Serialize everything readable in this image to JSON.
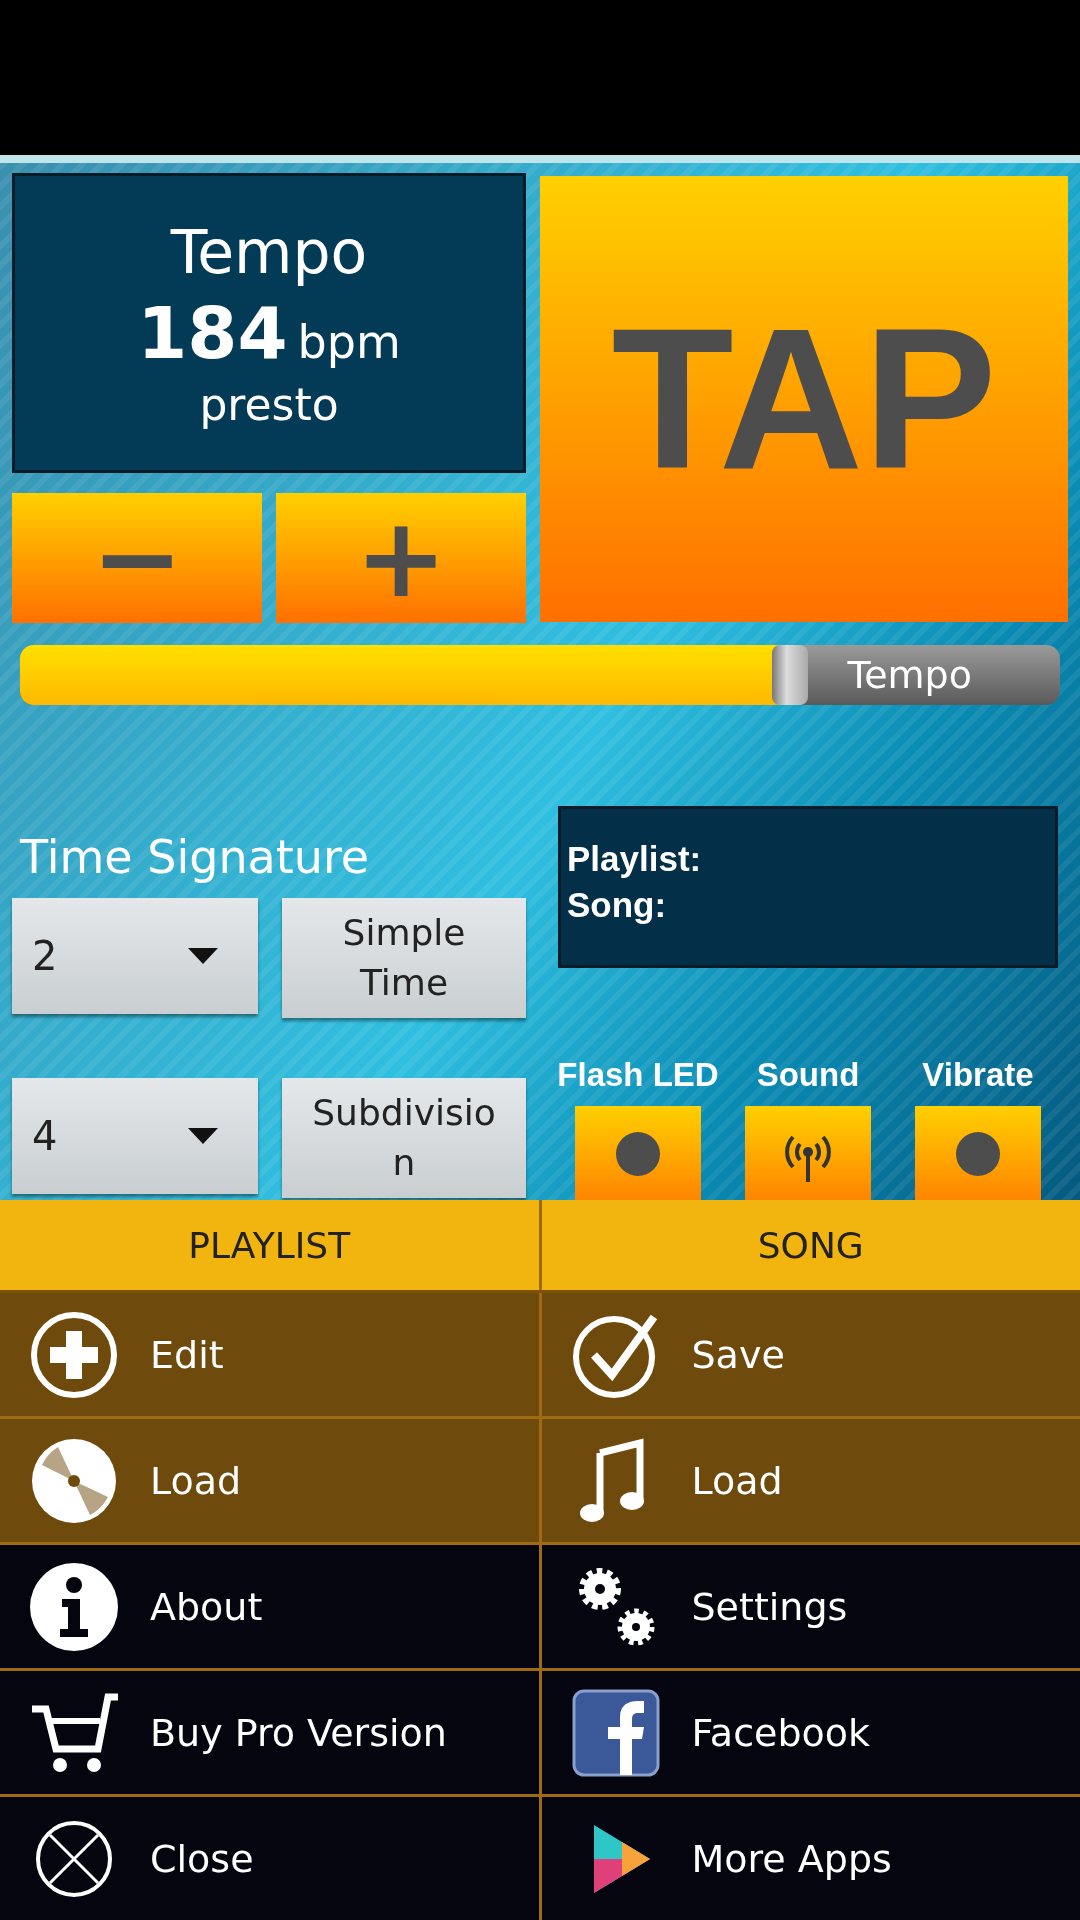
{
  "tempo_panel": {
    "title": "Tempo",
    "value": "184",
    "unit": "bpm",
    "marking": "presto"
  },
  "tap_button": {
    "label": "TAP"
  },
  "step_buttons": [
    {
      "label": "−"
    },
    {
      "label": "+"
    }
  ],
  "tempo_slider": {
    "label": "Tempo",
    "level": 0.74
  },
  "time_signature": {
    "title": "Time Signature",
    "rows": [
      {
        "dropdown": "2",
        "button": "Simple Time"
      },
      {
        "dropdown": "4",
        "button": "Subdivision"
      }
    ]
  },
  "info_panel": {
    "lines": [
      "Playlist:",
      "Song:"
    ]
  },
  "outputs": [
    {
      "label": "Flash LED",
      "on": false
    },
    {
      "label": "Sound",
      "on": true
    },
    {
      "label": "Vibrate",
      "on": false
    }
  ],
  "menu": {
    "headers": [
      "PLAYLIST",
      "SONG"
    ],
    "rows": [
      {
        "highlighted": true,
        "items": [
          {
            "label": "Edit"
          },
          {
            "label": "Save"
          }
        ]
      },
      {
        "highlighted": true,
        "items": [
          {
            "label": "Load"
          },
          {
            "label": "Load"
          }
        ]
      },
      {
        "highlighted": false,
        "items": [
          {
            "label": "About"
          },
          {
            "label": "Settings"
          }
        ]
      },
      {
        "highlighted": false,
        "items": [
          {
            "label": "Buy Pro Version"
          },
          {
            "label": "Facebook"
          }
        ]
      },
      {
        "highlighted": false,
        "items": [
          {
            "label": "Close"
          },
          {
            "label": "More Apps"
          }
        ]
      }
    ]
  }
}
